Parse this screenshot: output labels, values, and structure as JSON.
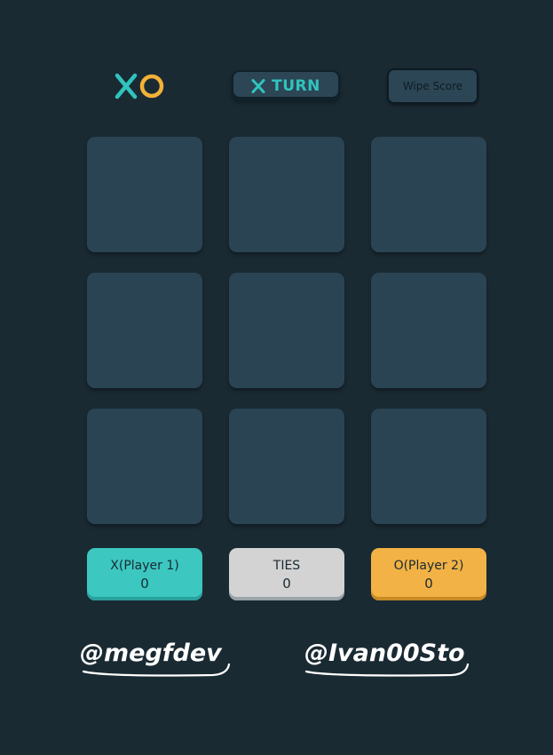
{
  "header": {
    "turn_label": "TURN",
    "turn_player_icon": "x-mark-icon",
    "wipe_score_label": "Wipe Score"
  },
  "board": {
    "cells": [
      "",
      "",
      "",
      "",
      "",
      "",
      "",
      "",
      ""
    ]
  },
  "scores": {
    "x": {
      "label": "X(Player 1)",
      "value": "0"
    },
    "ties": {
      "label": "TIES",
      "value": "0"
    },
    "o": {
      "label": "O(Player 2)",
      "value": "0"
    }
  },
  "credits": {
    "left": "@megfdev",
    "right": "@Ivan00Sto"
  },
  "colors": {
    "background": "#1a2a33",
    "cell": "#2b4453",
    "x_accent": "#31c3bd",
    "o_accent": "#f2b137",
    "ties": "#a8bfc9"
  }
}
